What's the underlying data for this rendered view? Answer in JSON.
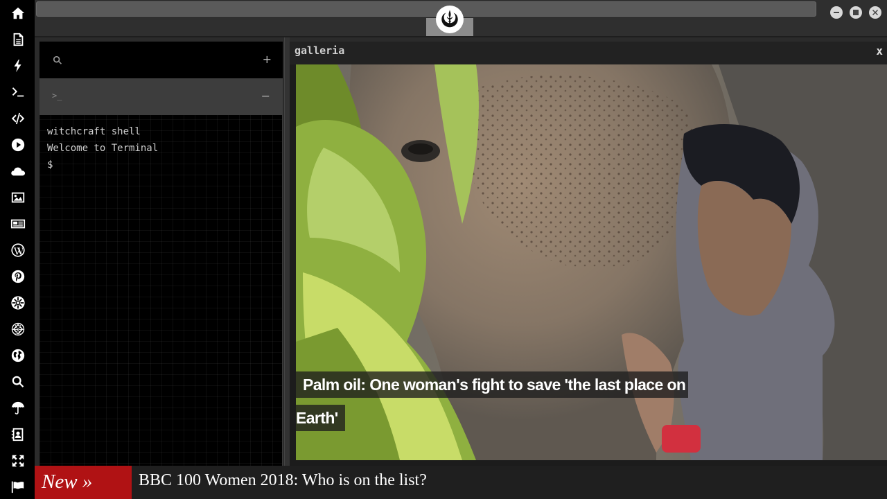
{
  "sidebar": {
    "icons": [
      "home-icon",
      "document-icon",
      "bolt-icon",
      "terminal-icon",
      "code-icon",
      "play-icon",
      "cloud-icon",
      "image-icon",
      "newspaper-icon",
      "wordpress-icon",
      "pinterest-icon",
      "galactic-empire-icon",
      "death-star-icon",
      "globe-icon",
      "search-icon",
      "umbrella-icon",
      "contacts-icon",
      "expand-icon",
      "flag-icon"
    ]
  },
  "topbar": {
    "logo": "rebel-alliance-icon"
  },
  "terminal": {
    "search_icon": "search-icon",
    "add_label": "+",
    "tab_prompt": ">_",
    "collapse_label": "−",
    "lines": [
      "witchcraft shell",
      "Welcome to Terminal",
      "$"
    ]
  },
  "galleria": {
    "title": "galleria",
    "close_label": "x",
    "caption_line1": "Palm oil: One woman's fight to save 'the last place on",
    "caption_line2": "Earth'"
  },
  "ticker": {
    "label": "New »",
    "headline": "BBC 100 Women 2018: Who is on the list?",
    "accent": "#b01214"
  }
}
